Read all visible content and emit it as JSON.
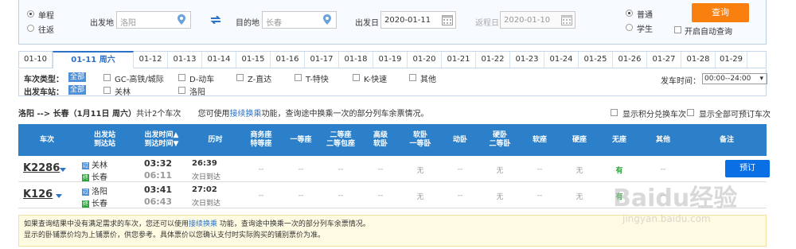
{
  "query": {
    "trip_one_way": "单程",
    "trip_round": "往返",
    "from_label": "出发地",
    "from_value": "洛阳",
    "to_label": "目的地",
    "to_value": "长春",
    "depart_label": "出发日",
    "depart_value": "2020-01-11",
    "return_label": "返程日",
    "return_value": "2020-01-10",
    "type_normal": "普通",
    "type_student": "学生",
    "search_button": "查询",
    "auto_query": "开启自动查询"
  },
  "tabs": [
    "01-10",
    "01-11 周六",
    "01-12",
    "01-13",
    "01-14",
    "01-15",
    "01-16",
    "01-17",
    "01-18",
    "01-19",
    "01-20",
    "01-21",
    "01-22",
    "01-23",
    "01-24",
    "01-25",
    "01-26",
    "01-27",
    "01-28",
    "01-29"
  ],
  "filter": {
    "type_label": "车次类型：",
    "all": "全部",
    "types": [
      "GC-高铁/城际",
      "D-动车",
      "Z-直达",
      "T-特快",
      "K-快速",
      "其他"
    ],
    "station_label": "出发车站：",
    "stations": [
      "关林",
      "洛阳"
    ],
    "time_label": "发车时间：",
    "time_value": "00:00--24:00"
  },
  "info": {
    "route": "洛阳 --> 长春（1月11日 周六）",
    "total": "共计2个车次",
    "tip_prefix": "您可使用",
    "tip_link": "接续换乘",
    "tip_suffix": "功能，查询途中换乘一次的部分列车余票情况。",
    "points_option": "显示积分兑换车次",
    "all_option": "显示全部可预订车次"
  },
  "table": {
    "headers": [
      "车次",
      "出发站\n到达站",
      "出发时间▲\n到达时间▼",
      "历时",
      "商务座\n特等座",
      "一等座",
      "二等座\n二等包座",
      "高级\n软卧",
      "软卧\n一等卧",
      "动卧",
      "硬卧\n二等卧",
      "软座",
      "硬座",
      "无座",
      "其他",
      "备注"
    ],
    "rows": [
      {
        "train": "K2286",
        "from": "关林",
        "to": "长春",
        "from_badge": "过",
        "to_badge": "终",
        "dep": "03:32",
        "arr": "06:11",
        "dur": "26:39",
        "arrive_note": "次日到达",
        "cells": [
          "--",
          "--",
          "--",
          "--",
          "无",
          "--",
          "无",
          "--",
          "无",
          "有",
          "--"
        ],
        "book": "预订"
      },
      {
        "train": "K126",
        "from": "洛阳",
        "to": "长春",
        "from_badge": "过",
        "to_badge": "终",
        "dep": "03:41",
        "arr": "06:43",
        "dur": "27:02",
        "arrive_note": "次日到达",
        "cells": [
          "--",
          "--",
          "--",
          "--",
          "无",
          "--",
          "无",
          "--",
          "无",
          "有",
          "--"
        ],
        "book": ""
      }
    ]
  },
  "note": {
    "line1_prefix": "如果查询结果中没有满足需求的车次，您还可以使用",
    "line1_link": "接续换乘",
    "line1_suffix": " 功能，查询途中换乘一次的部分列车余票情况。",
    "line2": "显示的卧铺票价均为上铺票价，供您参考。具体票价以您确认支付时实际购买的铺别票价为准。"
  },
  "watermark": {
    "brand": "Baidu经验",
    "url": "jingyan.baidu.com"
  },
  "colors": {
    "header_blue": "#2c7fc9",
    "orange": "#f97f0f",
    "book_blue": "#0a6ee5",
    "green": "#2aa23a"
  }
}
